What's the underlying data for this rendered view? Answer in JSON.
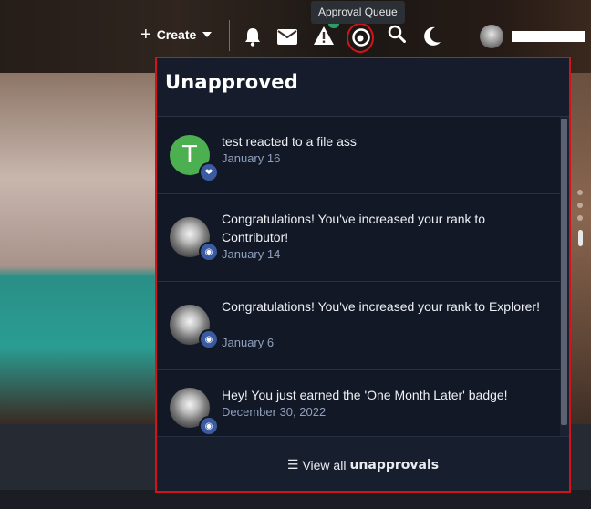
{
  "topbar": {
    "create_label": "Create",
    "tooltip": "Approval Queue",
    "icons": [
      "bell-icon",
      "envelope-icon",
      "warning-icon",
      "eye-icon",
      "search-icon",
      "moon-icon"
    ]
  },
  "panel": {
    "title": "Unapproved",
    "items": [
      {
        "text": "test reacted to a file ass",
        "date": "January 16",
        "avatar": "T",
        "badge": "heart-icon"
      },
      {
        "text": "Congratulations! You've increased your rank to Contributor!",
        "date": "January 14",
        "avatar": "wolf",
        "badge": "medal-icon"
      },
      {
        "text": "Congratulations! You've increased your rank to Explorer!",
        "date": "January 6",
        "avatar": "wolf",
        "badge": "medal-icon"
      },
      {
        "text": "Hey! You just earned the 'One Month Later' badge!",
        "date": "December 30, 2022",
        "avatar": "wolf",
        "badge": "medal-icon"
      }
    ],
    "footer_prefix": "View all",
    "footer_strong": "unapprovals"
  },
  "colors": {
    "accent_red": "#d0141a",
    "panel_bg": "#121826",
    "badge_blue": "#3a5ba0",
    "avatar_green": "#4caf50",
    "date_color": "#8fa0bd"
  }
}
